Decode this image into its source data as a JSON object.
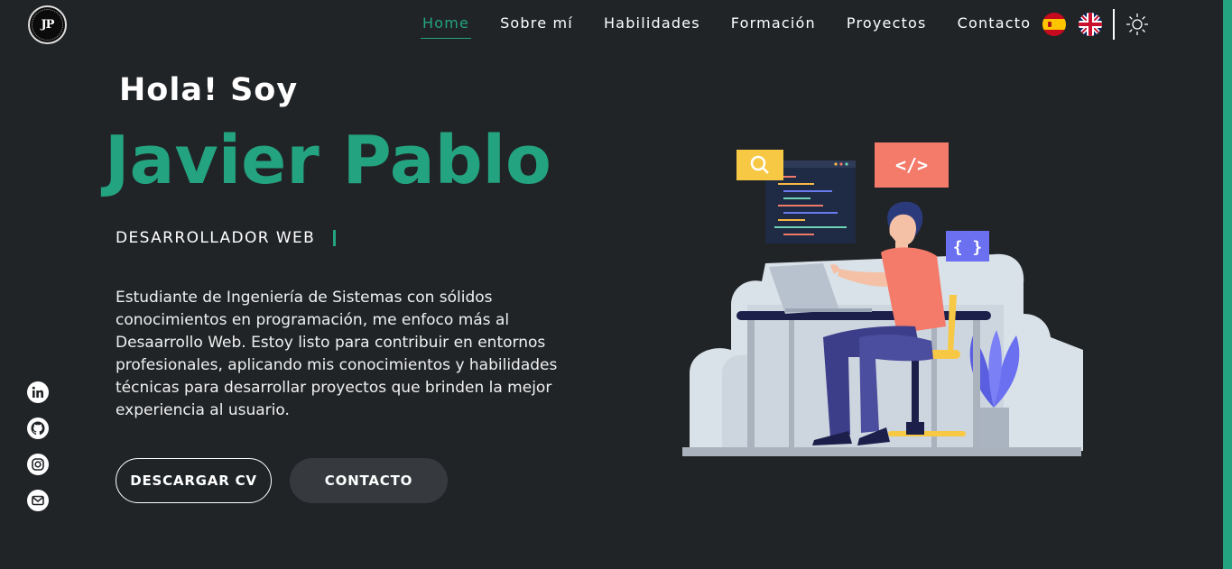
{
  "logo": {
    "initials": "JP"
  },
  "nav": {
    "items": [
      {
        "label": "Home",
        "active": true
      },
      {
        "label": "Sobre mí",
        "active": false
      },
      {
        "label": "Habilidades",
        "active": false
      },
      {
        "label": "Formación",
        "active": false
      },
      {
        "label": "Proyectos",
        "active": false
      },
      {
        "label": "Contacto",
        "active": false
      }
    ],
    "languages": [
      {
        "icon": "spain-flag-icon"
      },
      {
        "icon": "uk-flag-icon"
      }
    ],
    "theme_icon": "sun-icon"
  },
  "hero": {
    "greeting": "Hola! Soy",
    "name": "Javier Pablo",
    "role": "DESARROLLADOR WEB",
    "about": "Estudiante de Ingeniería de Sistemas con sólidos conocimientos en programación, me enfoco más al Desaarrollo Web. Estoy listo para contribuir en entornos profesionales, aplicando mis conocimientos y habilidades técnicas para desarrollar proyectos que brinden la mejor experiencia al usuario.",
    "buttons": {
      "cv_label": "DESCARGAR CV",
      "contact_label": "CONTACTO"
    }
  },
  "socials": [
    {
      "icon": "linkedin-icon"
    },
    {
      "icon": "github-icon"
    },
    {
      "icon": "instagram-icon"
    },
    {
      "icon": "email-icon"
    }
  ],
  "colors": {
    "background": "#212427",
    "accent": "#23a37f",
    "button_dark": "#363a3f",
    "text": "#ffffff"
  }
}
